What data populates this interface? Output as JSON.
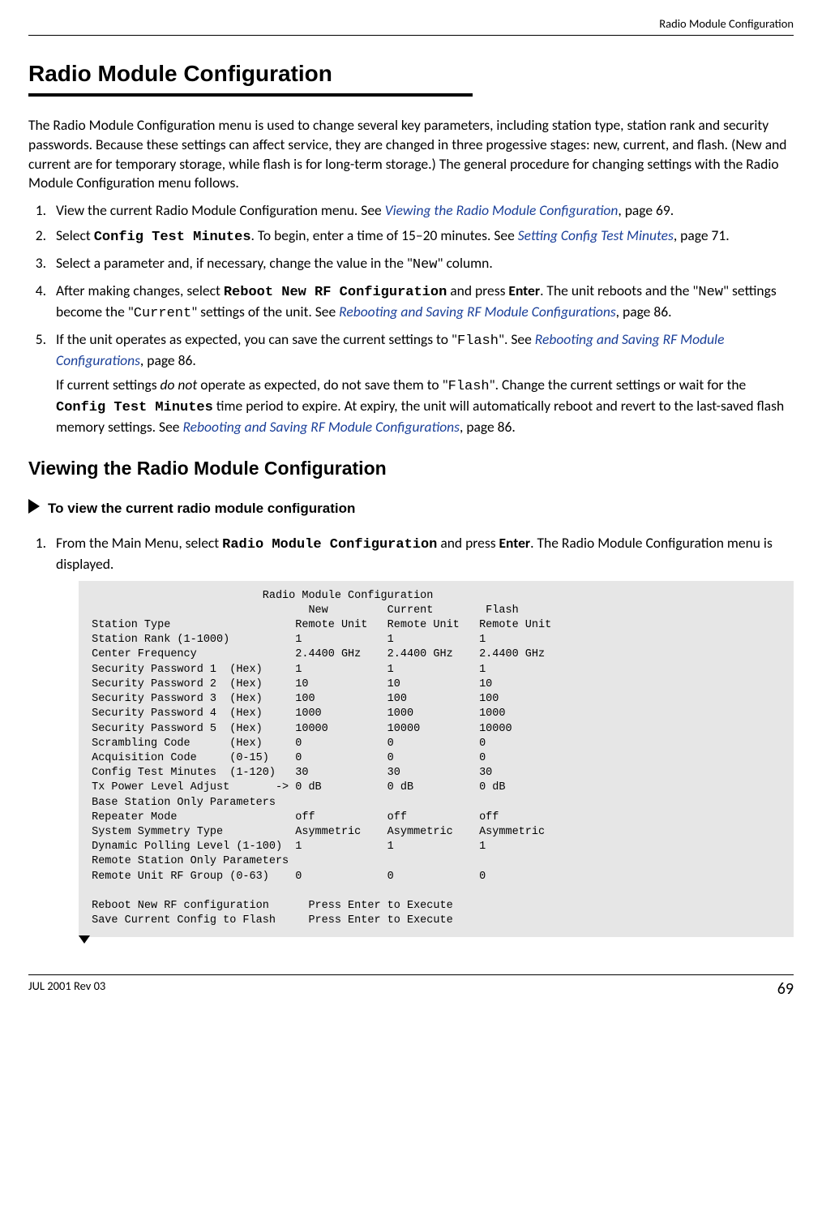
{
  "header": {
    "section": "Radio Module Configuration"
  },
  "title": "Radio Module Configuration",
  "intro": "The Radio Module Configuration menu is used to change several key parameters, including station type, station rank and security passwords. Because these settings can affect service, they are changed in three progessive stages: new, current, and flash. (New and current are for temporary storage, while flash is for long-term storage.) The general procedure for changing settings with the Radio Module Configuration menu follows.",
  "steps": {
    "s1": {
      "pre": "View the current Radio Module Configuration menu. See ",
      "link": "Viewing the Radio Module Configuration",
      "post": ", page 69."
    },
    "s2": {
      "pre": "Select ",
      "cmd": "Config Test Minutes",
      "mid": ". To begin, enter a time of 15–20 minutes. See ",
      "link": "Setting Config Test Minutes",
      "post": ", page 71."
    },
    "s3": {
      "pre": "Select a parameter and, if necessary, change the value in the \"",
      "code": "New",
      "post": "\" column."
    },
    "s4": {
      "pre": "After making changes, select ",
      "cmd": "Reboot New RF Configuration",
      "mid1": " and press ",
      "enter": "Enter",
      "mid2": ". The unit reboots and the \"",
      "code1": "New",
      "mid3": "\" settings become the \"",
      "code2": "Current",
      "mid4": "\" settings of the unit. See ",
      "link": "Rebooting and Saving RF Module Configurations",
      "post": ", page 86."
    },
    "s5": {
      "p1_pre": "If the unit operates as expected, you can save the current settings to \"",
      "p1_code": "Flash",
      "p1_mid": "\". See ",
      "p1_link": "Rebooting and Saving RF Module Configurations",
      "p1_post": ", page 86.",
      "p2_pre": "If current settings ",
      "p2_em": "do not",
      "p2_mid1": " operate as expected, do not save them to \"",
      "p2_code": "Flash",
      "p2_mid2": "\". Change the current settings or wait for the ",
      "p2_cmd": "Config Test Minutes",
      "p2_mid3": " time period to expire. At expiry, the unit will automatically reboot and revert to the last-saved flash memory settings. See ",
      "p2_link": "Rebooting and Saving RF Module Configurations",
      "p2_post": ", page 86."
    }
  },
  "section2": {
    "title": "Viewing the Radio Module Configuration",
    "subhead": "To view the current radio module configuration",
    "step1_pre": "From the Main Menu, select ",
    "step1_cmd": "Radio Module Configuration",
    "step1_mid": " and press ",
    "step1_enter": "Enter",
    "step1_post": ". The Radio Module Configuration menu is displayed."
  },
  "terminal": "                           Radio Module Configuration\n                                  New         Current        Flash\n Station Type                   Remote Unit   Remote Unit   Remote Unit\n Station Rank (1-1000)          1             1             1\n Center Frequency               2.4400 GHz    2.4400 GHz    2.4400 GHz\n Security Password 1  (Hex)     1             1             1\n Security Password 2  (Hex)     10            10            10\n Security Password 3  (Hex)     100           100           100\n Security Password 4  (Hex)     1000          1000          1000\n Security Password 5  (Hex)     10000         10000         10000\n Scrambling Code      (Hex)     0             0             0\n Acquisition Code     (0-15)    0             0             0\n Config Test Minutes  (1-120)   30            30            30\n Tx Power Level Adjust       -> 0 dB          0 dB          0 dB\n Base Station Only Parameters\n Repeater Mode                  off           off           off\n System Symmetry Type           Asymmetric    Asymmetric    Asymmetric\n Dynamic Polling Level (1-100)  1             1             1\n Remote Station Only Parameters\n Remote Unit RF Group (0-63)    0             0             0\n\n Reboot New RF configuration      Press Enter to Execute\n Save Current Config to Flash     Press Enter to Execute",
  "footer": {
    "rev": "JUL 2001 Rev 03",
    "page": "69"
  }
}
